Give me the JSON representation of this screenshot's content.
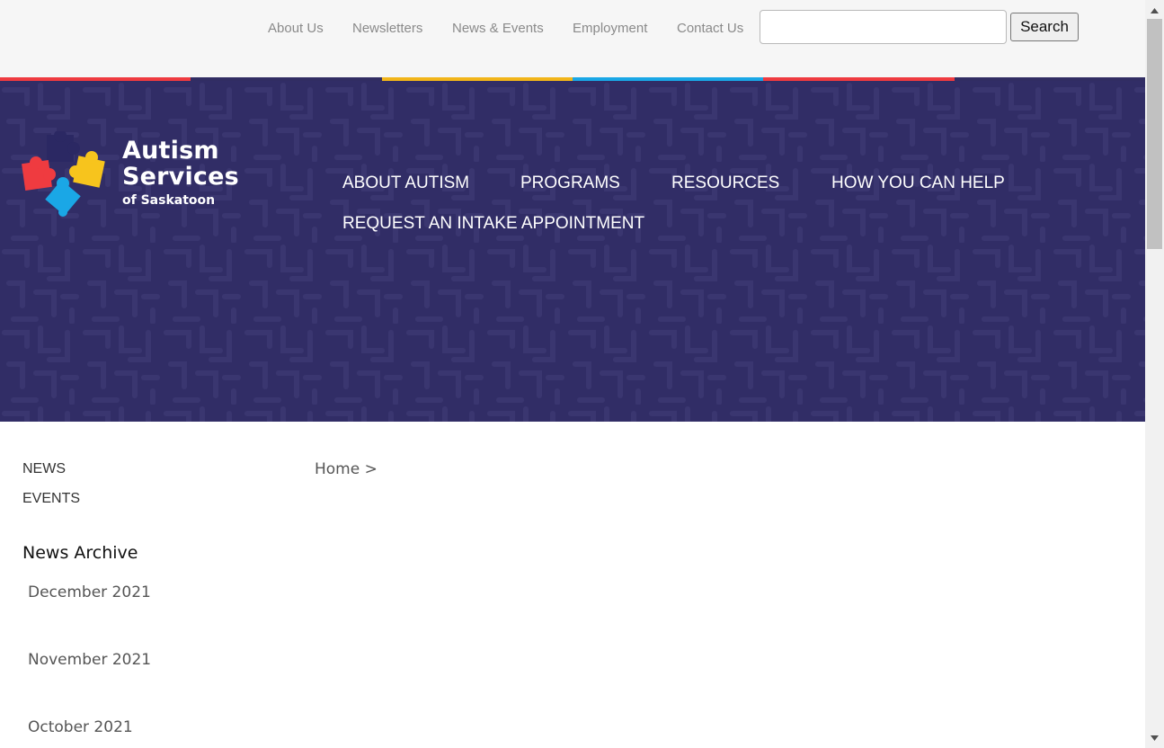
{
  "utility_nav": {
    "links": [
      "About Us",
      "Newsletters",
      "News & Events",
      "Employment",
      "Contact Us"
    ],
    "search": {
      "value": "",
      "placeholder": "",
      "button_label": "Search"
    }
  },
  "stripe_colors": [
    "#ef3b40",
    "#312d63",
    "#f2b51a",
    "#1aa7e6",
    "#ef3b40",
    "#312d63"
  ],
  "logo": {
    "line1": "Autism",
    "line2": "Services",
    "line3": "of Saskatoon",
    "puzzle_colors": {
      "navy": "#2b2863",
      "red": "#ef3b40",
      "yellow": "#f7c41d",
      "blue": "#1aa7e6"
    }
  },
  "main_nav": {
    "items": [
      "ABOUT AUTISM",
      "PROGRAMS",
      "RESOURCES",
      "HOW YOU CAN HELP",
      "REQUEST AN INTAKE APPOINTMENT"
    ]
  },
  "colors": {
    "banner": "#312d66",
    "utility_background": "#f6f6f6"
  },
  "sub_nav": {
    "items": [
      "NEWS",
      "EVENTS"
    ]
  },
  "breadcrumb": {
    "home": "Home",
    "separator": ">"
  },
  "archive": {
    "title": "News Archive",
    "items": [
      "December 2021",
      "November 2021",
      "October 2021"
    ]
  }
}
